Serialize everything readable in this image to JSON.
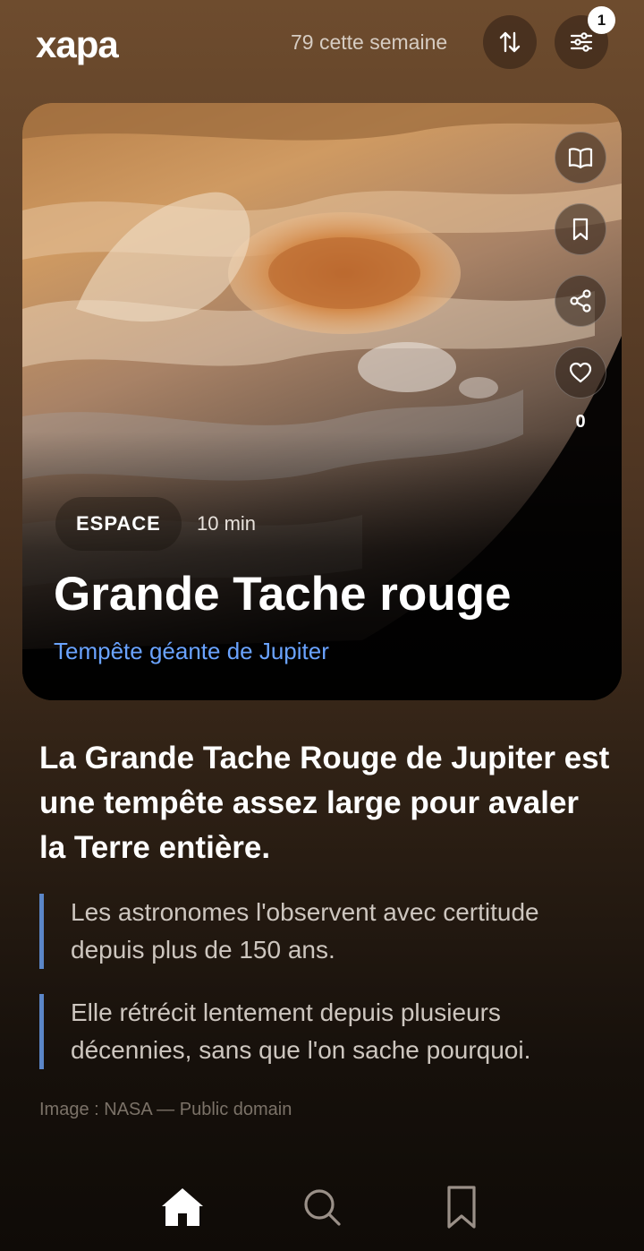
{
  "header": {
    "logo": "xapa",
    "week_count": "79 cette semaine",
    "filter_badge": "1",
    "sort_icon": "sort-arrows-icon",
    "filter_icon": "sliders-icon"
  },
  "card": {
    "image_description_icon": "jupiter-photo",
    "category": "ESPACE",
    "duration": "10 min",
    "title": "Grande Tache rouge",
    "subtitle": "Tempête géante de Jupiter",
    "like_count": "0",
    "actions": [
      "book-icon",
      "bookmark-icon",
      "share-icon",
      "heart-icon"
    ]
  },
  "article": {
    "lead": "La Grande Tache Rouge de Jupiter est une tempête assez large pour avaler la Terre entière.",
    "facts": [
      "Les astronomes l'observent avec certitude depuis plus de 150 ans.",
      "Elle rétrécit lentement depuis plusieurs décennies, sans que l'on sache pourquoi."
    ],
    "credit": "Image : NASA — Public domain"
  },
  "bottom_nav": [
    "home-icon",
    "search-icon",
    "bookmark-icon"
  ],
  "colors": {
    "accent_blue": "#6aa3ff",
    "quote_bar": "#5b86c8"
  }
}
